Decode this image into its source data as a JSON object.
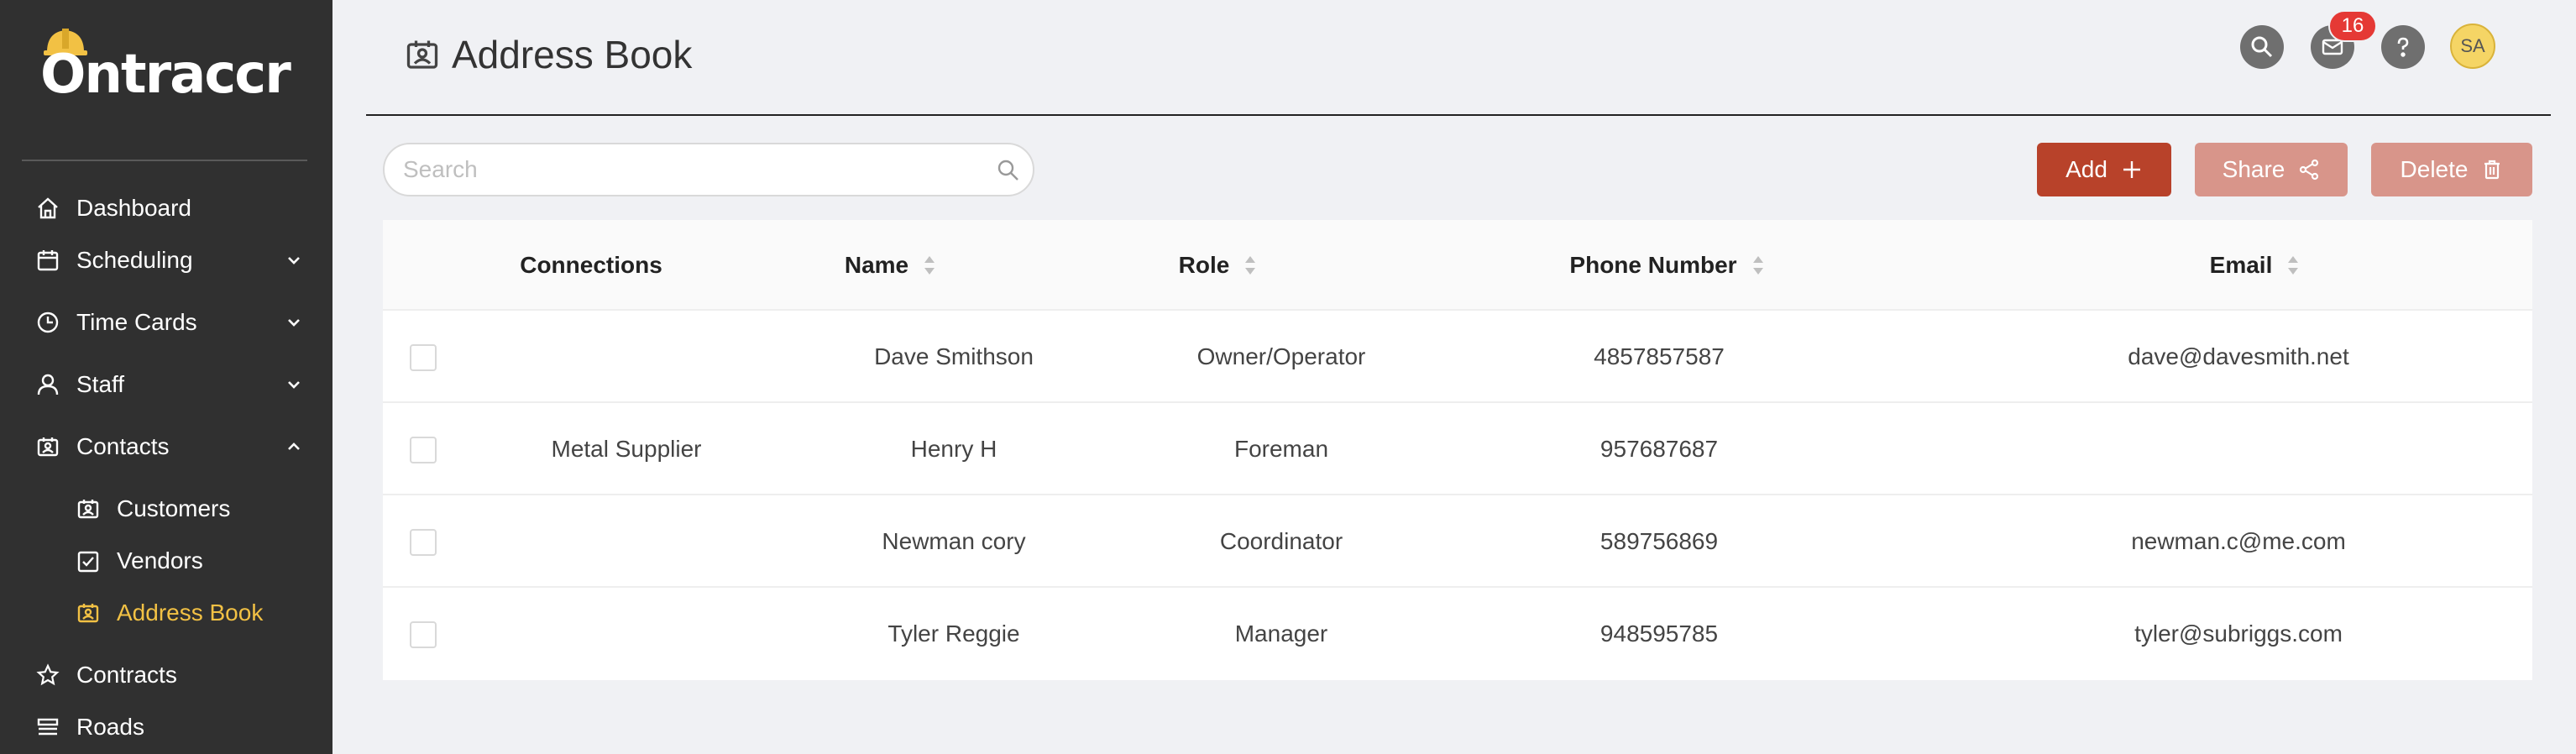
{
  "app": {
    "logo_text": "Ontraccr"
  },
  "sidebar": {
    "items": [
      {
        "label": "Dashboard",
        "icon": "home-icon"
      },
      {
        "label": "Scheduling",
        "icon": "calendar-icon",
        "chevron": "down"
      },
      {
        "label": "Time Cards",
        "icon": "clock-icon",
        "chevron": "down"
      },
      {
        "label": "Staff",
        "icon": "user-icon",
        "chevron": "down"
      },
      {
        "label": "Contacts",
        "icon": "contact-card-icon",
        "chevron": "up"
      },
      {
        "label": "Customers",
        "icon": "contact-card-icon",
        "sub": true
      },
      {
        "label": "Vendors",
        "icon": "checkbox-icon",
        "sub": true
      },
      {
        "label": "Address Book",
        "icon": "contact-card-icon",
        "sub": true,
        "active": true
      },
      {
        "label": "Contracts",
        "icon": "star-icon"
      },
      {
        "label": "Roads",
        "icon": "list-icon"
      }
    ],
    "active_color": "#f2c144"
  },
  "header": {
    "title": "Address Book",
    "notification_count": "16",
    "avatar_initials": "SA"
  },
  "toolbar": {
    "search_placeholder": "Search",
    "add_label": "Add",
    "share_label": "Share",
    "delete_label": "Delete"
  },
  "table": {
    "columns": [
      {
        "label": "Connections",
        "sortable": false
      },
      {
        "label": "Name",
        "sortable": true
      },
      {
        "label": "Role",
        "sortable": true
      },
      {
        "label": "Phone Number",
        "sortable": true
      },
      {
        "label": "Email",
        "sortable": true
      }
    ],
    "rows": [
      {
        "connections": "",
        "name": "Dave Smithson",
        "role": "Owner/Operator",
        "phone": "4857857587",
        "email": "dave@davesmith.net"
      },
      {
        "connections": "Metal Supplier",
        "name": "Henry H",
        "role": "Foreman",
        "phone": "957687687",
        "email": ""
      },
      {
        "connections": "",
        "name": "Newman cory",
        "role": "Coordinator",
        "phone": "589756869",
        "email": "newman.c@me.com"
      },
      {
        "connections": "",
        "name": "Tyler Reggie",
        "role": "Manager",
        "phone": "948595785",
        "email": "tyler@subriggs.com"
      }
    ]
  },
  "colors": {
    "sidebar_bg": "#303030",
    "primary_button": "#b8422a",
    "disabled_button": "#d8958a",
    "badge": "#e53935"
  }
}
